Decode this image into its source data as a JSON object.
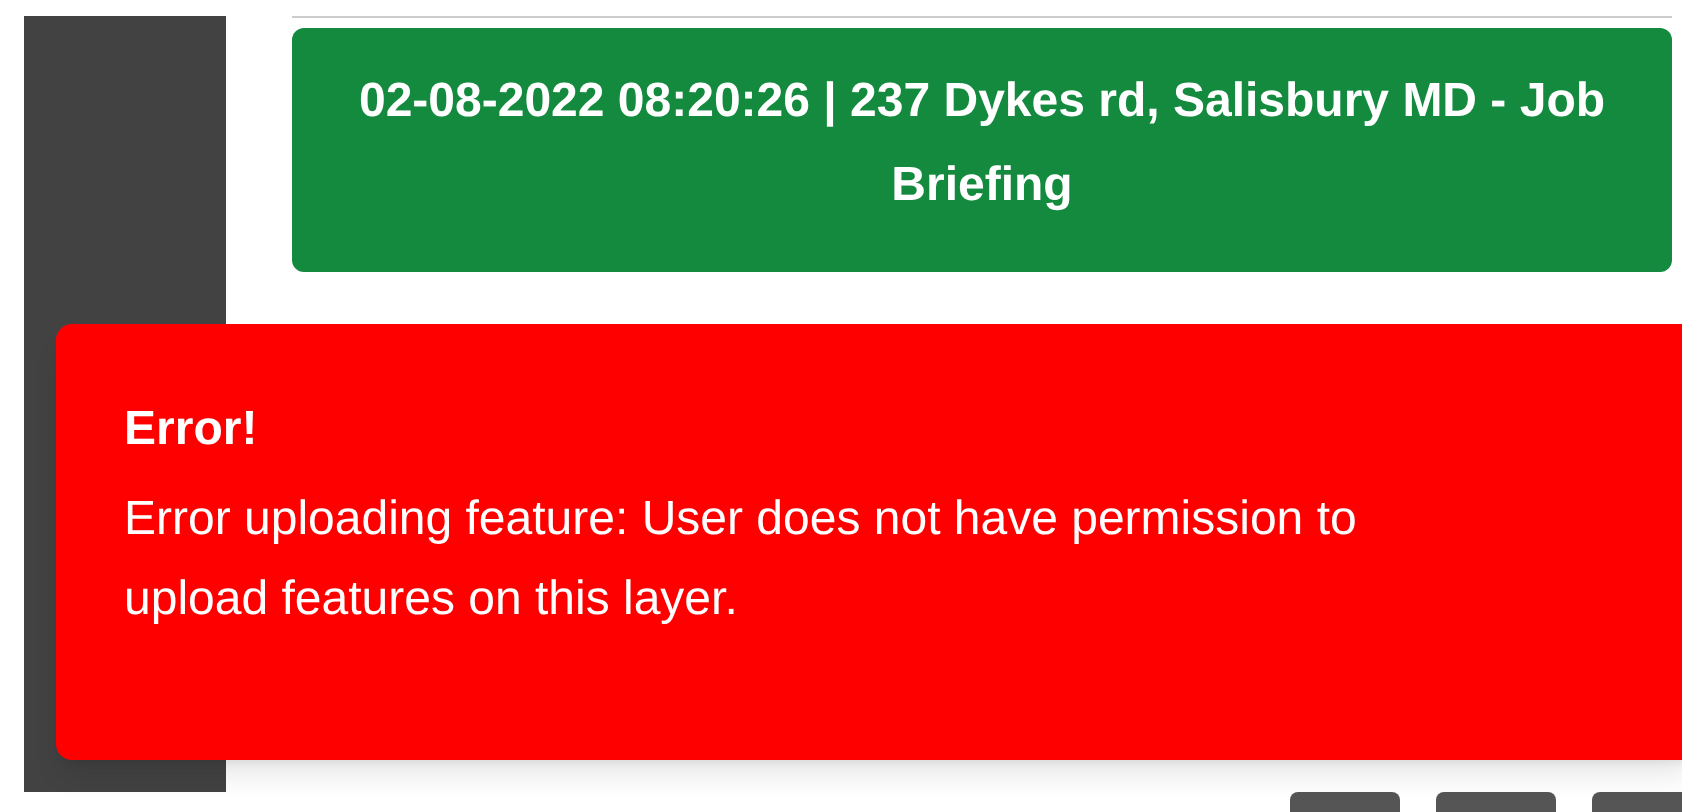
{
  "job_banner": {
    "title": "02-08-2022 08:20:26 | 237 Dykes rd, Salisbury MD - Job Briefing"
  },
  "toast": {
    "kind": "error",
    "title": "Error!",
    "message": "Error uploading feature: User does not have permission to upload features on this layer."
  }
}
